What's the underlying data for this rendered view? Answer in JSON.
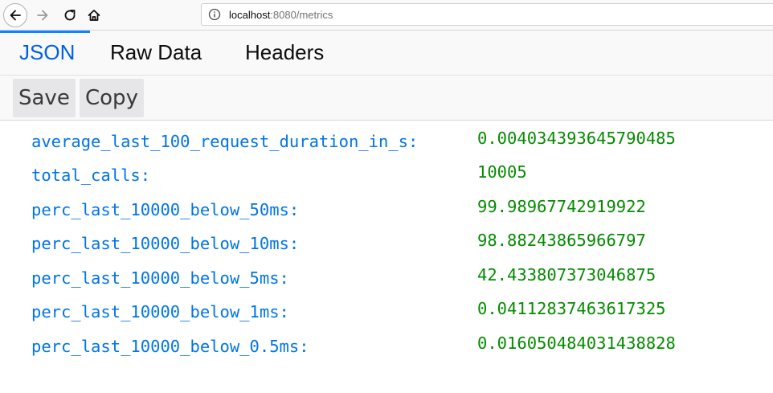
{
  "browser": {
    "url_host": "localhost",
    "url_rest": ":8080/metrics",
    "icons": {
      "back": "back-arrow-icon",
      "forward": "forward-arrow-icon",
      "reload": "reload-icon",
      "home": "home-icon",
      "info": "info-icon"
    }
  },
  "tabs": [
    {
      "label": "JSON",
      "active": true
    },
    {
      "label": "Raw Data",
      "active": false
    },
    {
      "label": "Headers",
      "active": false
    }
  ],
  "toolbar": {
    "save_label": "Save",
    "copy_label": "Copy"
  },
  "json": {
    "rows": [
      {
        "key": "average_last_100_request_duration_in_s:",
        "value": "0.004034393645790485"
      },
      {
        "key": "total_calls:",
        "value": "10005"
      },
      {
        "key": "perc_last_10000_below_50ms:",
        "value": "99.98967742919922"
      },
      {
        "key": "perc_last_10000_below_10ms:",
        "value": "98.88243865966797"
      },
      {
        "key": "perc_last_10000_below_5ms:",
        "value": "42.433807373046875"
      },
      {
        "key": "perc_last_10000_below_1ms:",
        "value": "0.04112837463617325"
      },
      {
        "key": "perc_last_10000_below_0.5ms:",
        "value": "0.016050484031438828"
      }
    ]
  },
  "colors": {
    "key": "#0074e8",
    "value": "#058b00",
    "active_tab": "#0060df",
    "tab_indicator": "#0a84ff"
  }
}
